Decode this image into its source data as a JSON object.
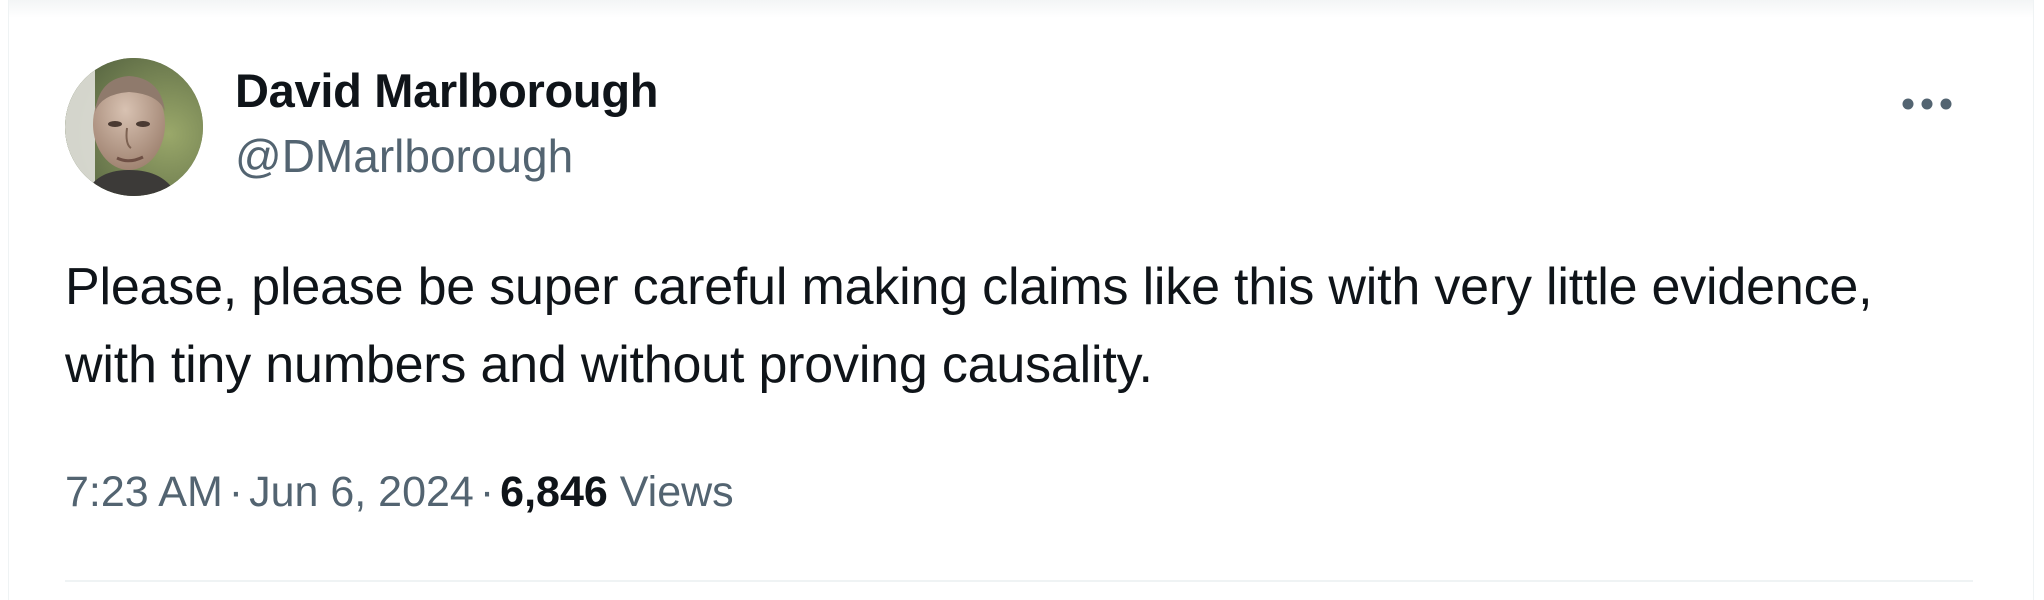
{
  "tweet": {
    "author": {
      "display_name": "David Marlborough",
      "handle": "@DMarlborough",
      "avatar_icon": "profile-photo"
    },
    "more_icon": "ellipsis-icon",
    "text": "Please, please be super careful making claims like this with very little evidence, with tiny numbers and without proving causality.",
    "time": "7:23 AM",
    "separator": "·",
    "date": "Jun 6, 2024",
    "views_count": "6,846",
    "views_label": "Views"
  },
  "colors": {
    "text_primary": "#0f1419",
    "text_secondary": "#536471",
    "border": "#eff3f4",
    "background": "#ffffff"
  }
}
